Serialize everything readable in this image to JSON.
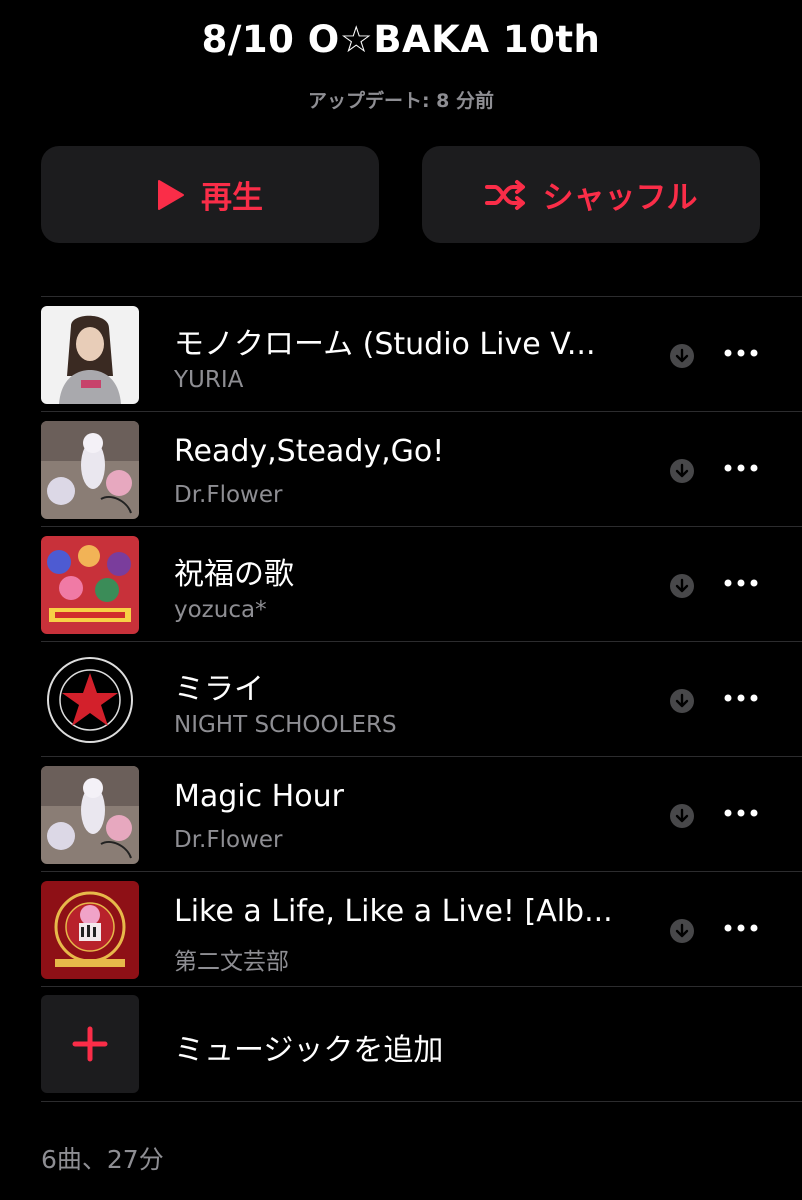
{
  "header": {
    "title": "8/10 O☆BAKA 10th",
    "updated": "アップデート: 8 分前"
  },
  "actions": {
    "play_label": "再生",
    "shuffle_label": "シャッフル",
    "accent_color": "#fa2d48"
  },
  "tracks": [
    {
      "title": "モノクローム (Studio Live V...",
      "artist": "YURIA",
      "artwork": "portrait-photo"
    },
    {
      "title": "Ready,Steady,Go!",
      "artist": "Dr.Flower",
      "artwork": "anime-illustration"
    },
    {
      "title": "祝福の歌",
      "artist": "yozuca*",
      "artwork": "anime-group"
    },
    {
      "title": "ミライ",
      "artist": "NIGHT SCHOOLERS",
      "artwork": "star-records-logo"
    },
    {
      "title": "Magic Hour",
      "artist": "Dr.Flower",
      "artwork": "anime-illustration"
    },
    {
      "title": "Like a Life, Like a Live! [Alb...",
      "artist": "第二文芸部",
      "artwork": "anime-red-emblem"
    }
  ],
  "add_music_label": "ミュージックを追加",
  "summary": "6曲、27分",
  "icons": {
    "play": "play-icon",
    "shuffle": "shuffle-icon",
    "download": "download-icon",
    "more": "more-icon",
    "add": "plus-icon"
  }
}
